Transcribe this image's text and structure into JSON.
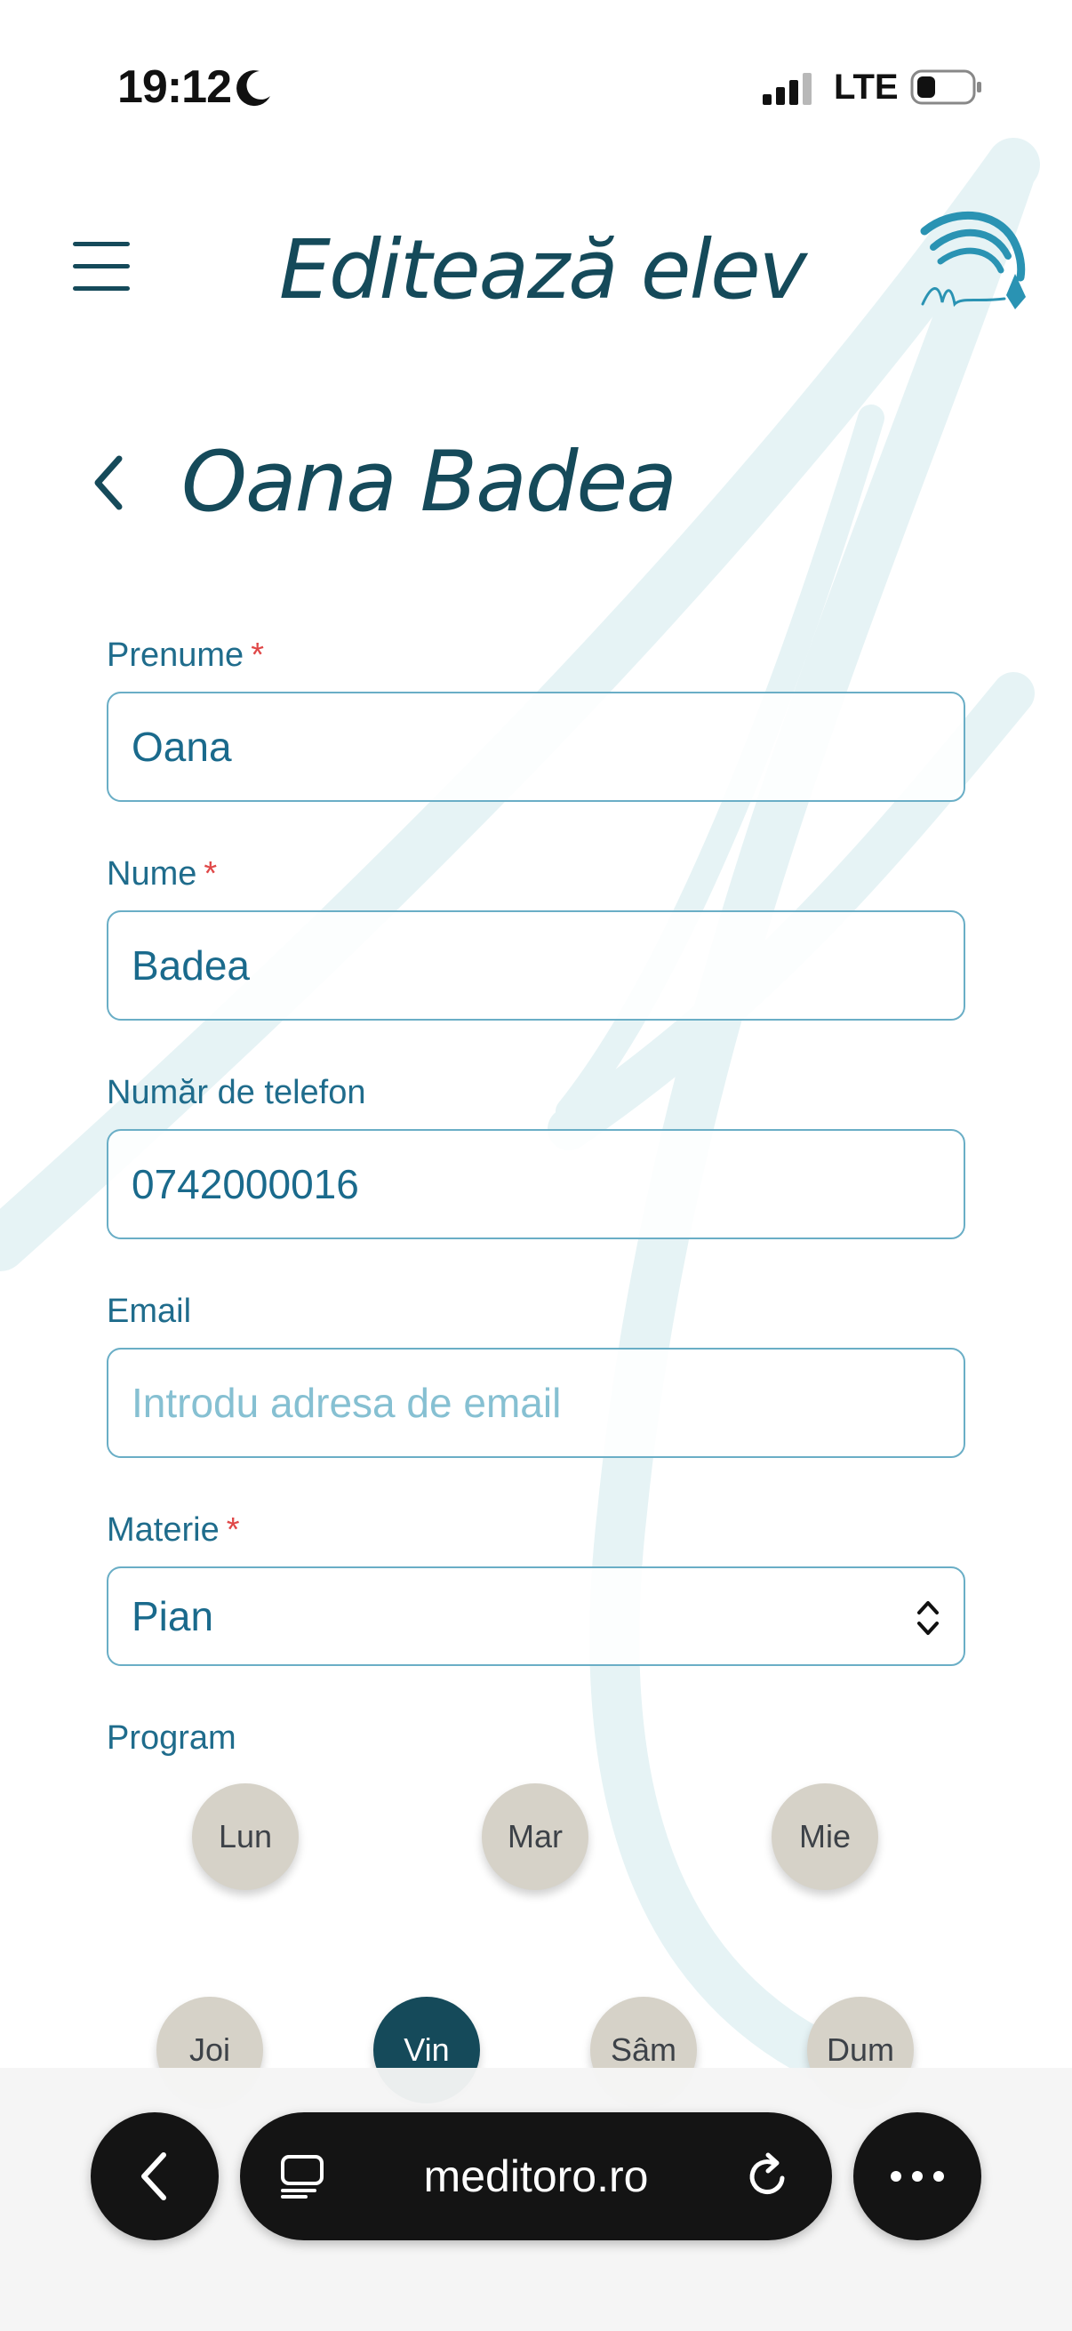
{
  "status_bar": {
    "time": "19:12",
    "network": "LTE"
  },
  "header": {
    "title": "Editează elev"
  },
  "student": {
    "name": "Oana Badea"
  },
  "form": {
    "first_name": {
      "label": "Prenume",
      "required_mark": "*",
      "value": "Oana"
    },
    "last_name": {
      "label": "Nume",
      "required_mark": "*",
      "value": "Badea"
    },
    "phone": {
      "label": "Număr de telefon",
      "value": "0742000016"
    },
    "email": {
      "label": "Email",
      "placeholder": "Introdu adresa de email",
      "value": ""
    },
    "subject": {
      "label": "Materie",
      "required_mark": "*",
      "value": "Pian"
    },
    "program": {
      "label": "Program",
      "days": [
        {
          "label": "Lun",
          "selected": false
        },
        {
          "label": "Mar",
          "selected": false
        },
        {
          "label": "Mie",
          "selected": false
        },
        {
          "label": "Joi",
          "selected": false
        },
        {
          "label": "Vin",
          "selected": true
        },
        {
          "label": "Sâm",
          "selected": false
        },
        {
          "label": "Dum",
          "selected": false
        }
      ]
    }
  },
  "browser": {
    "url": "meditoro.ro"
  },
  "colors": {
    "brand_dark": "#154a5a",
    "field_border": "#6aaec6",
    "label": "#1f6c8c",
    "required": "#e04848",
    "day_chip": "#d6d2c8",
    "day_chip_active": "#154a5a"
  }
}
